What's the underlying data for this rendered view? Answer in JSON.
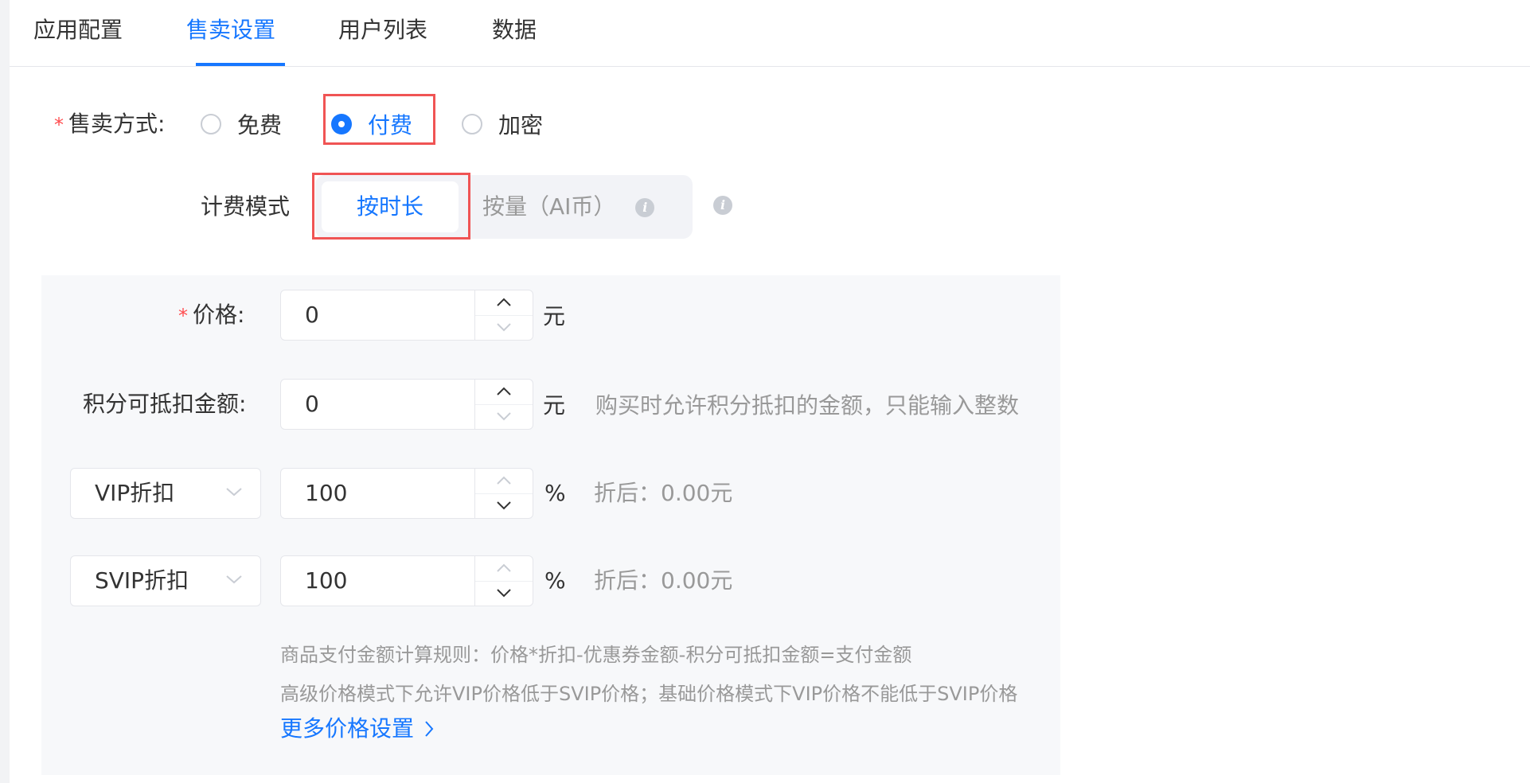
{
  "tabs": [
    {
      "label": "应用配置",
      "active": false
    },
    {
      "label": "售卖设置",
      "active": true
    },
    {
      "label": "用户列表",
      "active": false
    },
    {
      "label": "数据",
      "active": false
    }
  ],
  "sale_mode": {
    "label": "售卖方式:",
    "required": "*",
    "options": [
      {
        "label": "免费",
        "checked": false
      },
      {
        "label": "付费",
        "checked": true
      },
      {
        "label": "加密",
        "checked": false
      }
    ]
  },
  "billing_mode": {
    "label": "计费模式",
    "options": [
      {
        "label": "按时长",
        "active": true
      },
      {
        "label": "按量（AI币）",
        "active": false
      }
    ]
  },
  "price": {
    "label": "价格:",
    "required": "*",
    "value": "0",
    "unit": "元"
  },
  "points_deduct": {
    "label": "积分可抵扣金额:",
    "value": "0",
    "unit": "元",
    "hint": "购买时允许积分抵扣的金额，只能输入整数"
  },
  "vip_discount": {
    "selected": "VIP折扣",
    "value": "100",
    "unit": "%",
    "after": "折后：0.00元"
  },
  "svip_discount": {
    "selected": "SVIP折扣",
    "value": "100",
    "unit": "%",
    "after": "折后：0.00元"
  },
  "rules": {
    "line1": "商品支付金额计算规则：价格*折扣-优惠券金额-积分可抵扣金额=支付金额",
    "line2": "高级价格模式下允许VIP价格低于SVIP价格；基础价格模式下VIP价格不能低于SVIP价格"
  },
  "more_settings": "更多价格设置",
  "colors": {
    "accent": "#1677ff",
    "required": "#ff4d4f",
    "highlight": "#f05454",
    "muted": "#999999"
  },
  "icons": {
    "info": "i"
  }
}
